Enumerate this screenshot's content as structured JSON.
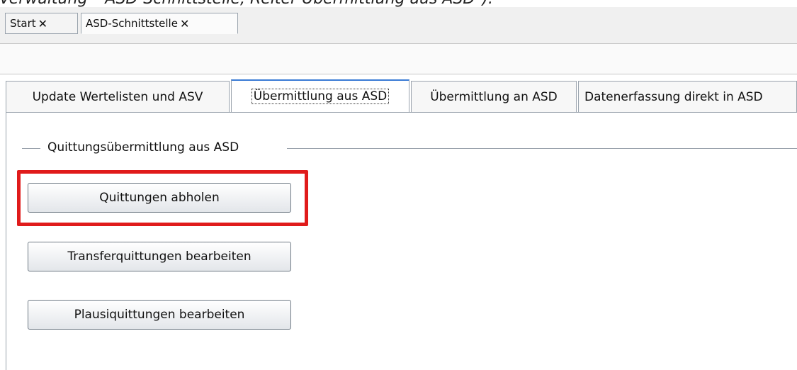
{
  "caption": "Verwaltung – ASD-Schnittstelle, Reiter Übermittlung aus ASD\").",
  "doc_tabs": [
    {
      "label": "Start",
      "close": "✕"
    },
    {
      "label": "ASD-Schnittstelle",
      "close": "✕"
    }
  ],
  "inner_tabs": [
    {
      "label": "Update Wertelisten und ASV"
    },
    {
      "label": "Übermittlung aus ASD"
    },
    {
      "label": "Übermittlung an ASD"
    },
    {
      "label": "Datenerfassung direkt in ASD"
    }
  ],
  "group": {
    "title": "Quittungsübermittlung aus ASD"
  },
  "buttons": [
    {
      "label": "Quittungen abholen"
    },
    {
      "label": "Transferquittungen bearbeiten"
    },
    {
      "label": "Plausiquittungen bearbeiten"
    }
  ],
  "colors": {
    "highlight": "#e01b1b",
    "active_tab_accent": "#3a7bd5"
  }
}
